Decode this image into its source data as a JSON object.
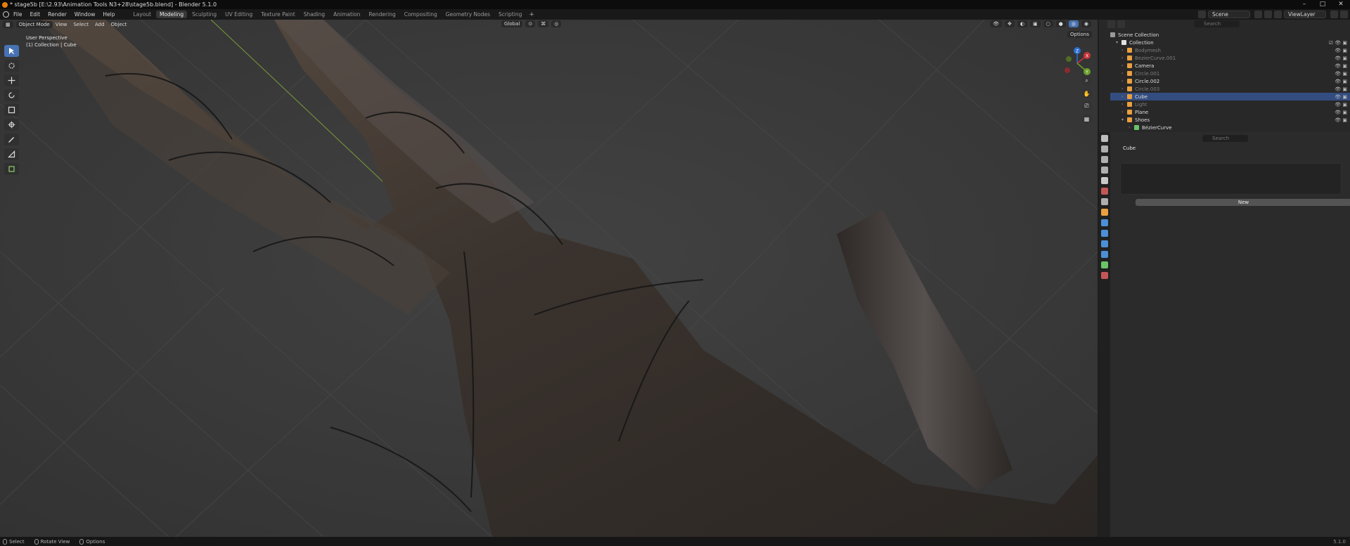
{
  "window": {
    "title": "* stage5b [E:\\2.93\\Animation Tools N3+28\\stage5b.blend] - Blender 5.1.0",
    "controls": [
      "–",
      "□",
      "✕"
    ]
  },
  "topbar": {
    "menus": [
      "File",
      "Edit",
      "Render",
      "Window",
      "Help"
    ],
    "workspaces": [
      "Layout",
      "Modeling",
      "Sculpting",
      "UV Editing",
      "Texture Paint",
      "Shading",
      "Animation",
      "Rendering",
      "Compositing",
      "Geometry Nodes",
      "Scripting"
    ],
    "active_workspace": "Modeling",
    "add_workspace": "+",
    "scene": "Scene",
    "view_layer": "ViewLayer"
  },
  "viewport": {
    "mode": "Object Mode",
    "menus": [
      "View",
      "Select",
      "Add",
      "Object"
    ],
    "orientation": "Global",
    "options": "Options",
    "info_line1": "User Perspective",
    "info_line2": "(1) Collection | Cube",
    "gizmo": {
      "x": "X",
      "y": "Y",
      "z": "Z"
    }
  },
  "outliner": {
    "search_placeholder": "Search",
    "root": "Scene Collection",
    "collection": "Collection",
    "items": [
      {
        "name": "Bodymesh",
        "dim": true
      },
      {
        "name": "BezierCurve.001",
        "dim": true
      },
      {
        "name": "Camera",
        "dim": false
      },
      {
        "name": "Circle.001",
        "dim": true
      },
      {
        "name": "Circle.002",
        "dim": false
      },
      {
        "name": "Circle.003",
        "dim": true
      },
      {
        "name": "Cube",
        "dim": false,
        "selected": true
      },
      {
        "name": "Light",
        "dim": true
      },
      {
        "name": "Plane",
        "dim": false
      },
      {
        "name": "Shoes",
        "dim": false
      },
      {
        "name": "BézierCurve",
        "dim": false
      }
    ]
  },
  "properties": {
    "search_placeholder": "Search",
    "object_name": "Cube",
    "new_label": "New",
    "add_label": "+"
  },
  "statusbar": {
    "items": [
      "Select",
      "Rotate View",
      "Options"
    ],
    "version": "5.1.0"
  },
  "colors": {
    "accent": "#4772b3",
    "selected_row": "#334d80",
    "header_bg": "#191919"
  }
}
